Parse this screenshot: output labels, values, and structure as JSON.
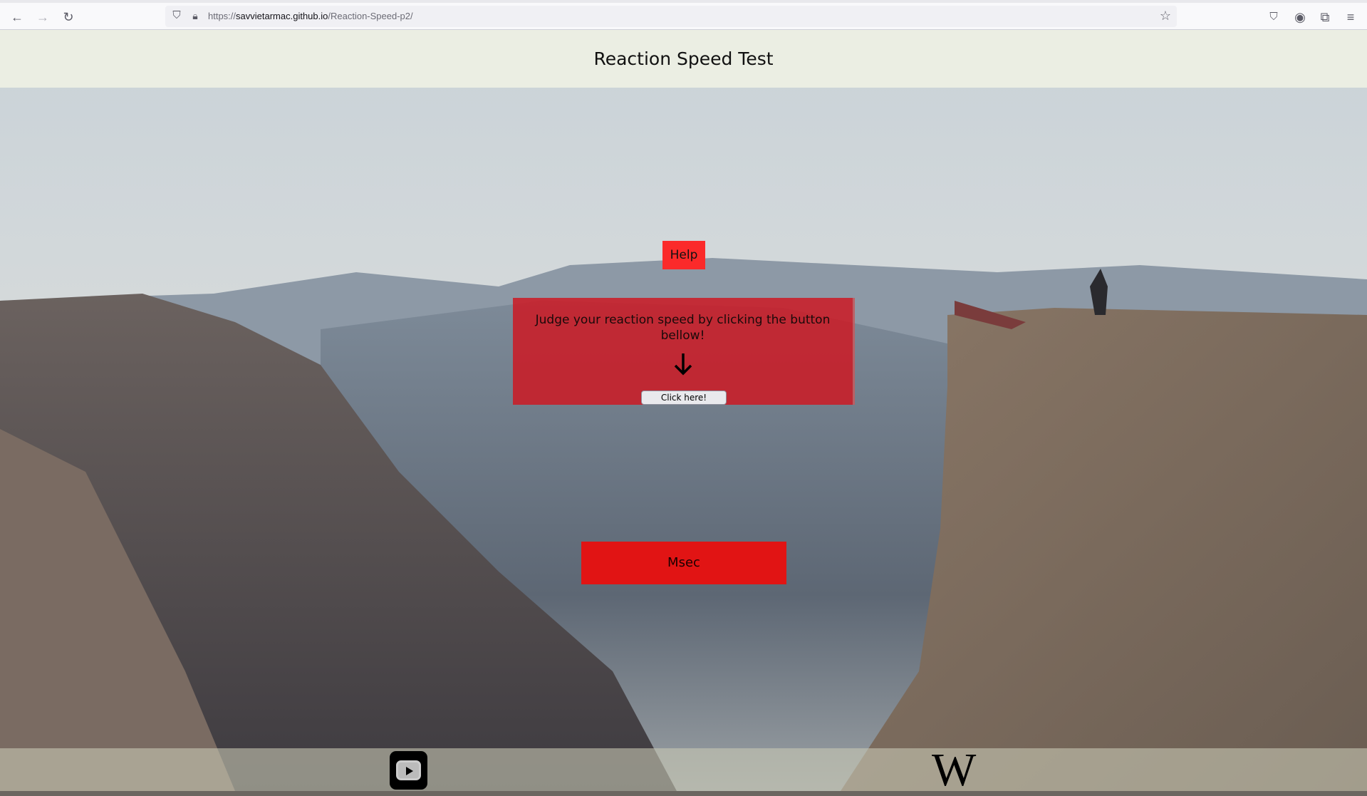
{
  "browser": {
    "url_prefix": "https://",
    "url_domain": "savvietarmac.github.io",
    "url_path": "/Reaction-Speed-p2/",
    "icons": [
      "back-icon",
      "forward-icon",
      "reload-icon",
      "shield-icon",
      "lock-icon",
      "star-icon",
      "pocket-icon",
      "account-icon",
      "extensions-icon",
      "menu-icon"
    ]
  },
  "header": {
    "title": "Reaction Speed Test"
  },
  "help_button": "Help",
  "panel": {
    "instructions": "Judge your reaction speed by clicking the button bellow!",
    "click_button": "Click here!"
  },
  "result": {
    "label": "Msec"
  },
  "footer": {
    "wikipedia_logo": "W"
  },
  "colors": {
    "help": "#fb2a2a",
    "panel": "#cd1923",
    "result": "#e11414"
  }
}
